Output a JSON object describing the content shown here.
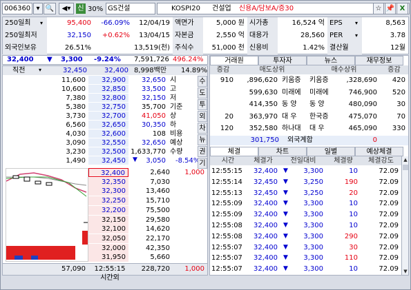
{
  "toolbar": {
    "code": "006360",
    "search_icon": "search-icon",
    "speaker_icon": "speaker-icon",
    "tag": "신",
    "margin": "30%",
    "name": "GS건설",
    "index": "KOSPI20",
    "sector": "건설업",
    "credit": "신용A/담보A/증30",
    "icons": [
      "star-icon",
      "pin-icon",
      "excel-icon"
    ]
  },
  "summary": {
    "rows": [
      {
        "label": "250일최",
        "value": "95,400",
        "change": "-66.09%",
        "date": "12/04/19",
        "k1": "액면가",
        "v1": "5,000 원",
        "k2": "시가총",
        "v2": "16,524 억",
        "k3": "EPS",
        "v3": "8,563"
      },
      {
        "label": "250일최저",
        "value": "32,150",
        "change": "+0.62%",
        "date": "13/04/15",
        "k1": "자본금",
        "v1": "2,550 억",
        "k2": "대용가",
        "v2": "28,560",
        "k3": "PER",
        "v3": "3.78"
      },
      {
        "label": "외국인보유",
        "value": "26.51%",
        "change": "13,519(천)",
        "date": "",
        "k1": "주식수",
        "v1": "51,000 천",
        "k2": "신용비",
        "v2": "1.42%",
        "k3": "결산월",
        "v3": "12월"
      }
    ]
  },
  "quote": {
    "price": "32,400",
    "diff": "3,300",
    "rate": "-9.24%",
    "volume": "7,591,726",
    "vol_rate": "496.24%"
  },
  "orderbook": {
    "header": {
      "mode": "직전",
      "prev": "32,450",
      "cur": "32,400",
      "amount": "8,998백만",
      "ratio": "14.89%"
    },
    "asks": [
      {
        "qty": "11,600",
        "price": "32,900"
      },
      {
        "qty": "10,600",
        "price": "32,850"
      },
      {
        "qty": "7,380",
        "price": "32,800"
      },
      {
        "qty": "5,380",
        "price": "32,750"
      },
      {
        "qty": "3,730",
        "price": "32,700"
      },
      {
        "qty": "6,560",
        "price": "32,650"
      },
      {
        "qty": "4,030",
        "price": "32,600"
      },
      {
        "qty": "3,090",
        "price": "32,550"
      },
      {
        "qty": "3,230",
        "price": "32,500"
      },
      {
        "qty": "1,490",
        "price": "32,450"
      }
    ],
    "info": [
      {
        "v": "32,650",
        "k": "시"
      },
      {
        "v": "33,500",
        "k": "고"
      },
      {
        "v": "32,150",
        "k": "저"
      },
      {
        "v": "35,700",
        "k": "기준"
      },
      {
        "v": "41,050",
        "k": "상"
      },
      {
        "v": "30,350",
        "k": "하"
      },
      {
        "v": "108",
        "k": "비용"
      },
      {
        "v": "32,650",
        "k": "예상"
      },
      {
        "v": "1,633,770",
        "k": "수량"
      },
      {
        "v": "3,050",
        "k": "-8.54%"
      }
    ],
    "side_tabs": [
      "수",
      "도",
      "투",
      "외",
      "차",
      "뉴",
      "권",
      "기"
    ],
    "bids": [
      {
        "price": "32,400",
        "qty": "2,640",
        "extra": "1,000"
      },
      {
        "price": "32,350",
        "qty": "7,030",
        "extra": ""
      },
      {
        "price": "32,300",
        "qty": "13,460",
        "extra": ""
      },
      {
        "price": "32,250",
        "qty": "15,710",
        "extra": ""
      },
      {
        "price": "32,200",
        "qty": "75,500",
        "extra": ""
      },
      {
        "price": "32,150",
        "qty": "29,580",
        "extra": ""
      },
      {
        "price": "32,100",
        "qty": "14,620",
        "extra": ""
      },
      {
        "price": "32,050",
        "qty": "22,170",
        "extra": ""
      },
      {
        "price": "32,000",
        "qty": "42,350",
        "extra": ""
      },
      {
        "price": "31,950",
        "qty": "5,660",
        "extra": ""
      }
    ],
    "footer": {
      "total_ask": "57,090",
      "time": "12:55:15",
      "total_bid": "228,720",
      "extra": "1,000",
      "after_hours": "시간외"
    }
  },
  "broker": {
    "tabs": [
      "거래원",
      "투자자",
      "뉴스",
      "재무정보"
    ],
    "headers": [
      "증감",
      "매도상위",
      "매수상위",
      "증감"
    ],
    "rows": [
      {
        "l_inc": "910",
        "l_qty": ",896,620",
        "l_name": "키움증",
        "r_name": "키움증",
        ",r_qty": "",
        "r_qty2": ",328,690",
        "r_inc": "420"
      },
      {
        "l_inc": "",
        "l_qty": "599,630",
        "l_name": "미래에",
        "r_name": "미래에",
        "r_qty2": "746,900",
        "r_inc": "520"
      },
      {
        "l_inc": "",
        "l_qty": "414,350",
        "l_name": "동 양",
        "r_name": "동 양",
        "r_qty2": "480,090",
        "r_inc": "30"
      },
      {
        "l_inc": "20",
        "l_qty": "363,970",
        "l_name": "대 우",
        "r_name": "한국증",
        "r_qty2": "475,070",
        "r_inc": "70"
      },
      {
        "l_inc": "120",
        "l_qty": "352,580",
        "l_name": "하나대",
        "r_name": "대 우",
        "r_qty2": "465,090",
        "r_inc": "330"
      }
    ],
    "foreign": {
      "qty": "301,750",
      "label": "외국계합",
      "val": "0"
    }
  },
  "trades": {
    "tabs": [
      "체결",
      "차트",
      "일별",
      "예상체결"
    ],
    "headers": [
      "시간",
      "체결가",
      "전일대비",
      "체결량",
      "체결강도"
    ],
    "rows": [
      {
        "t": "12:55:15",
        "p": "32,400",
        "d": "3,300",
        "q": "10",
        "s": "72.09"
      },
      {
        "t": "12:55:14",
        "p": "32,450",
        "d": "3,250",
        "q": "190",
        "s": "72.09"
      },
      {
        "t": "12:55:13",
        "p": "32,450",
        "d": "3,250",
        "q": "20",
        "s": "72.09"
      },
      {
        "t": "12:55:09",
        "p": "32,400",
        "d": "3,300",
        "q": "10",
        "s": "72.09"
      },
      {
        "t": "12:55:09",
        "p": "32,400",
        "d": "3,300",
        "q": "10",
        "s": "72.09"
      },
      {
        "t": "12:55:08",
        "p": "32,400",
        "d": "3,300",
        "q": "10",
        "s": "72.09"
      },
      {
        "t": "12:55:08",
        "p": "32,400",
        "d": "3,300",
        "q": "290",
        "s": "72.09"
      },
      {
        "t": "12:55:07",
        "p": "32,400",
        "d": "3,300",
        "q": "30",
        "s": "72.09"
      },
      {
        "t": "12:55:07",
        "p": "32,400",
        "d": "3,300",
        "q": "110",
        "s": "72.09"
      },
      {
        "t": "12:55:07",
        "p": "32,400",
        "d": "3,300",
        "q": "10",
        "s": "72.09"
      }
    ]
  }
}
